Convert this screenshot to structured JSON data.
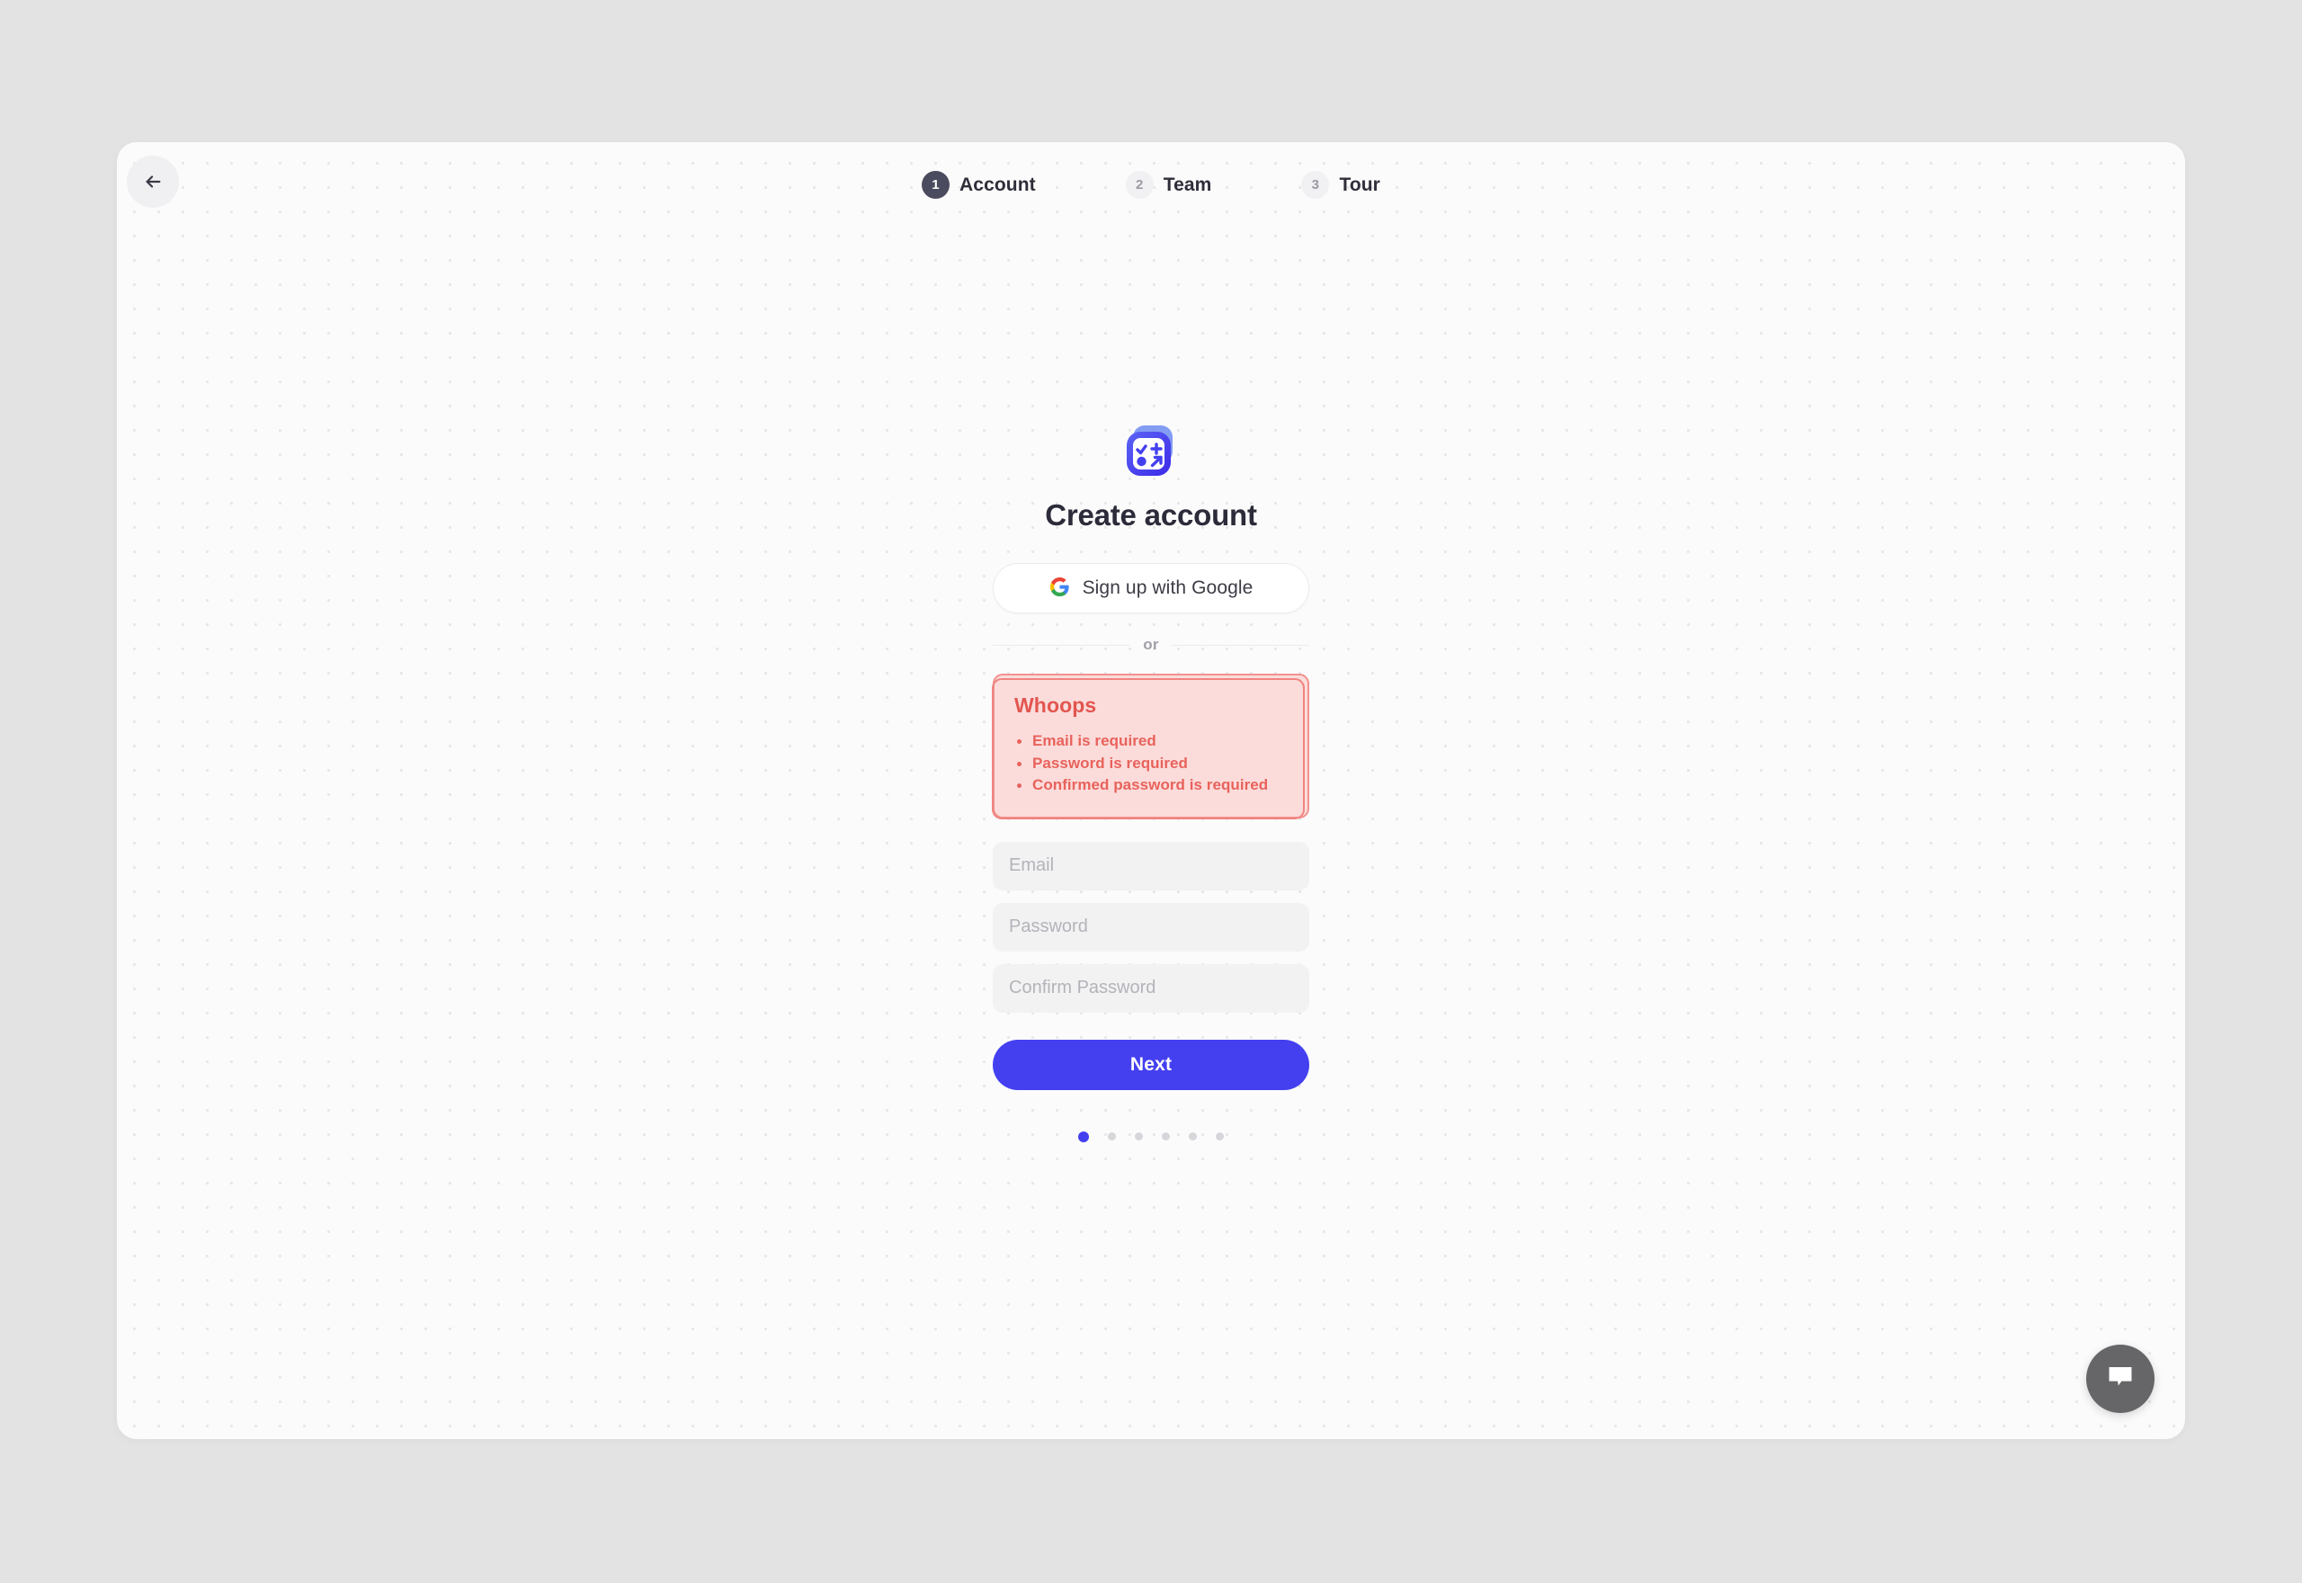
{
  "colors": {
    "page_background": "#e3e3e3",
    "card_background": "#fbfbfb",
    "primary": "#4440f0",
    "step_active": "#4b4b5f",
    "error_text": "#e8625b",
    "error_title": "#e2564f",
    "error_background": "#fbdcdb",
    "error_border": "#f2918d",
    "input_background": "#f2f2f3",
    "placeholder": "#b3b3ba",
    "chat_bubble": "#666668"
  },
  "back_button": {
    "icon": "arrow-left-icon",
    "label": ""
  },
  "stepper": {
    "steps": [
      {
        "number": "1",
        "label": "Account",
        "state": "active"
      },
      {
        "number": "2",
        "label": "Team",
        "state": "inactive"
      },
      {
        "number": "3",
        "label": "Tour",
        "state": "inactive"
      }
    ]
  },
  "brand": {
    "logo_icon": "app-logo-icon"
  },
  "main": {
    "title": "Create account",
    "google_button": {
      "icon": "google-icon",
      "label": "Sign up with Google"
    },
    "divider_text": "or",
    "error": {
      "title": "Whoops",
      "items": [
        "Email is required",
        "Password is required",
        "Confirmed password is required"
      ]
    },
    "fields": [
      {
        "name": "email",
        "placeholder": "Email",
        "value": ""
      },
      {
        "name": "password",
        "placeholder": "Password",
        "value": ""
      },
      {
        "name": "confirm_password",
        "placeholder": "Confirm Password",
        "value": ""
      }
    ],
    "submit_label": "Next"
  },
  "pagination": {
    "total": 6,
    "active_index": 0
  },
  "chat": {
    "icon": "chat-bubble-icon"
  }
}
